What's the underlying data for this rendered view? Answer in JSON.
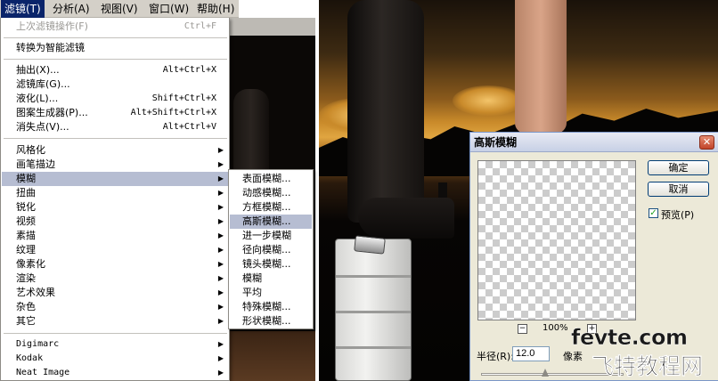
{
  "menubar": {
    "items": [
      "滤镜(T)",
      "分析(A)",
      "视图(V)",
      "窗口(W)",
      "帮助(H)"
    ]
  },
  "filter_menu": {
    "last_filter": {
      "label": "上次滤镜操作(F)",
      "shortcut": "Ctrl+F"
    },
    "smart": "转换为智能滤镜",
    "group1": [
      {
        "label": "抽出(X)...",
        "shortcut": "Alt+Ctrl+X"
      },
      {
        "label": "滤镜库(G)...",
        "shortcut": ""
      },
      {
        "label": "液化(L)...",
        "shortcut": "Shift+Ctrl+X"
      },
      {
        "label": "图案生成器(P)...",
        "shortcut": "Alt+Shift+Ctrl+X"
      },
      {
        "label": "消失点(V)...",
        "shortcut": "Alt+Ctrl+V"
      }
    ],
    "group2": [
      "风格化",
      "画笔描边",
      "模糊",
      "扭曲",
      "锐化",
      "视频",
      "素描",
      "纹理",
      "像素化",
      "渲染",
      "艺术效果",
      "杂色",
      "其它"
    ],
    "group3": [
      "Digimarc",
      "Kodak",
      "Neat Image"
    ],
    "submenu_arrow": "▶"
  },
  "blur_submenu": [
    "表面模糊...",
    "动感模糊...",
    "方框模糊...",
    "高斯模糊...",
    "进一步模糊",
    "径向模糊...",
    "镜头模糊...",
    "模糊",
    "平均",
    "特殊模糊...",
    "形状模糊..."
  ],
  "dialog": {
    "title": "高斯模糊",
    "close": "✕",
    "ok": "确定",
    "cancel": "取消",
    "preview_label": "预览(P)",
    "preview_checked": true,
    "check": "✓",
    "zoom_minus": "−",
    "zoom_plus": "+",
    "zoom": "100%",
    "radius_label": "半径(R):",
    "radius_value": "12.0",
    "radius_unit": "像素",
    "radius_slider_level": 0.45
  },
  "watermark": {
    "line1": "fevte.com",
    "line2": "飞特教程网"
  }
}
